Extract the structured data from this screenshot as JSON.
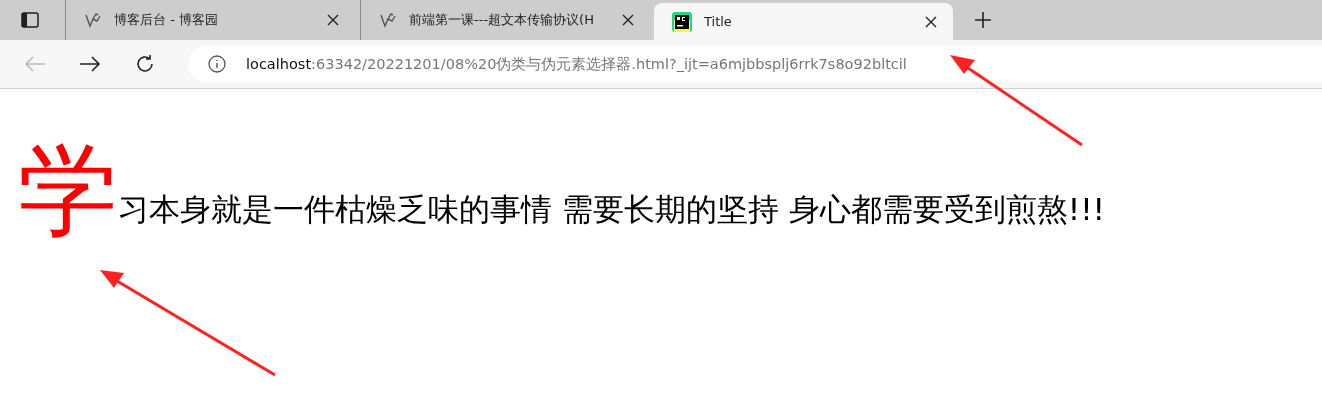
{
  "tabs": [
    {
      "kind": "blog",
      "title": "博客后台 - 博客园",
      "selected": false
    },
    {
      "kind": "blog",
      "title": "前端第一课---超文本传输协议(H",
      "selected": false
    },
    {
      "kind": "pycharm",
      "title": "Title",
      "selected": true
    }
  ],
  "address": {
    "host": "localhost",
    "rest": ":63342/20221201/08%20伪类与伪元素选择器.html?_ijt=a6mjbbsplj6rrk7s8o92bltcil"
  },
  "content": {
    "first_letter": "学",
    "rest": "习本身就是一件枯燥乏味的事情 需要长期的坚持 身心都需要受到煎熬!!!"
  }
}
